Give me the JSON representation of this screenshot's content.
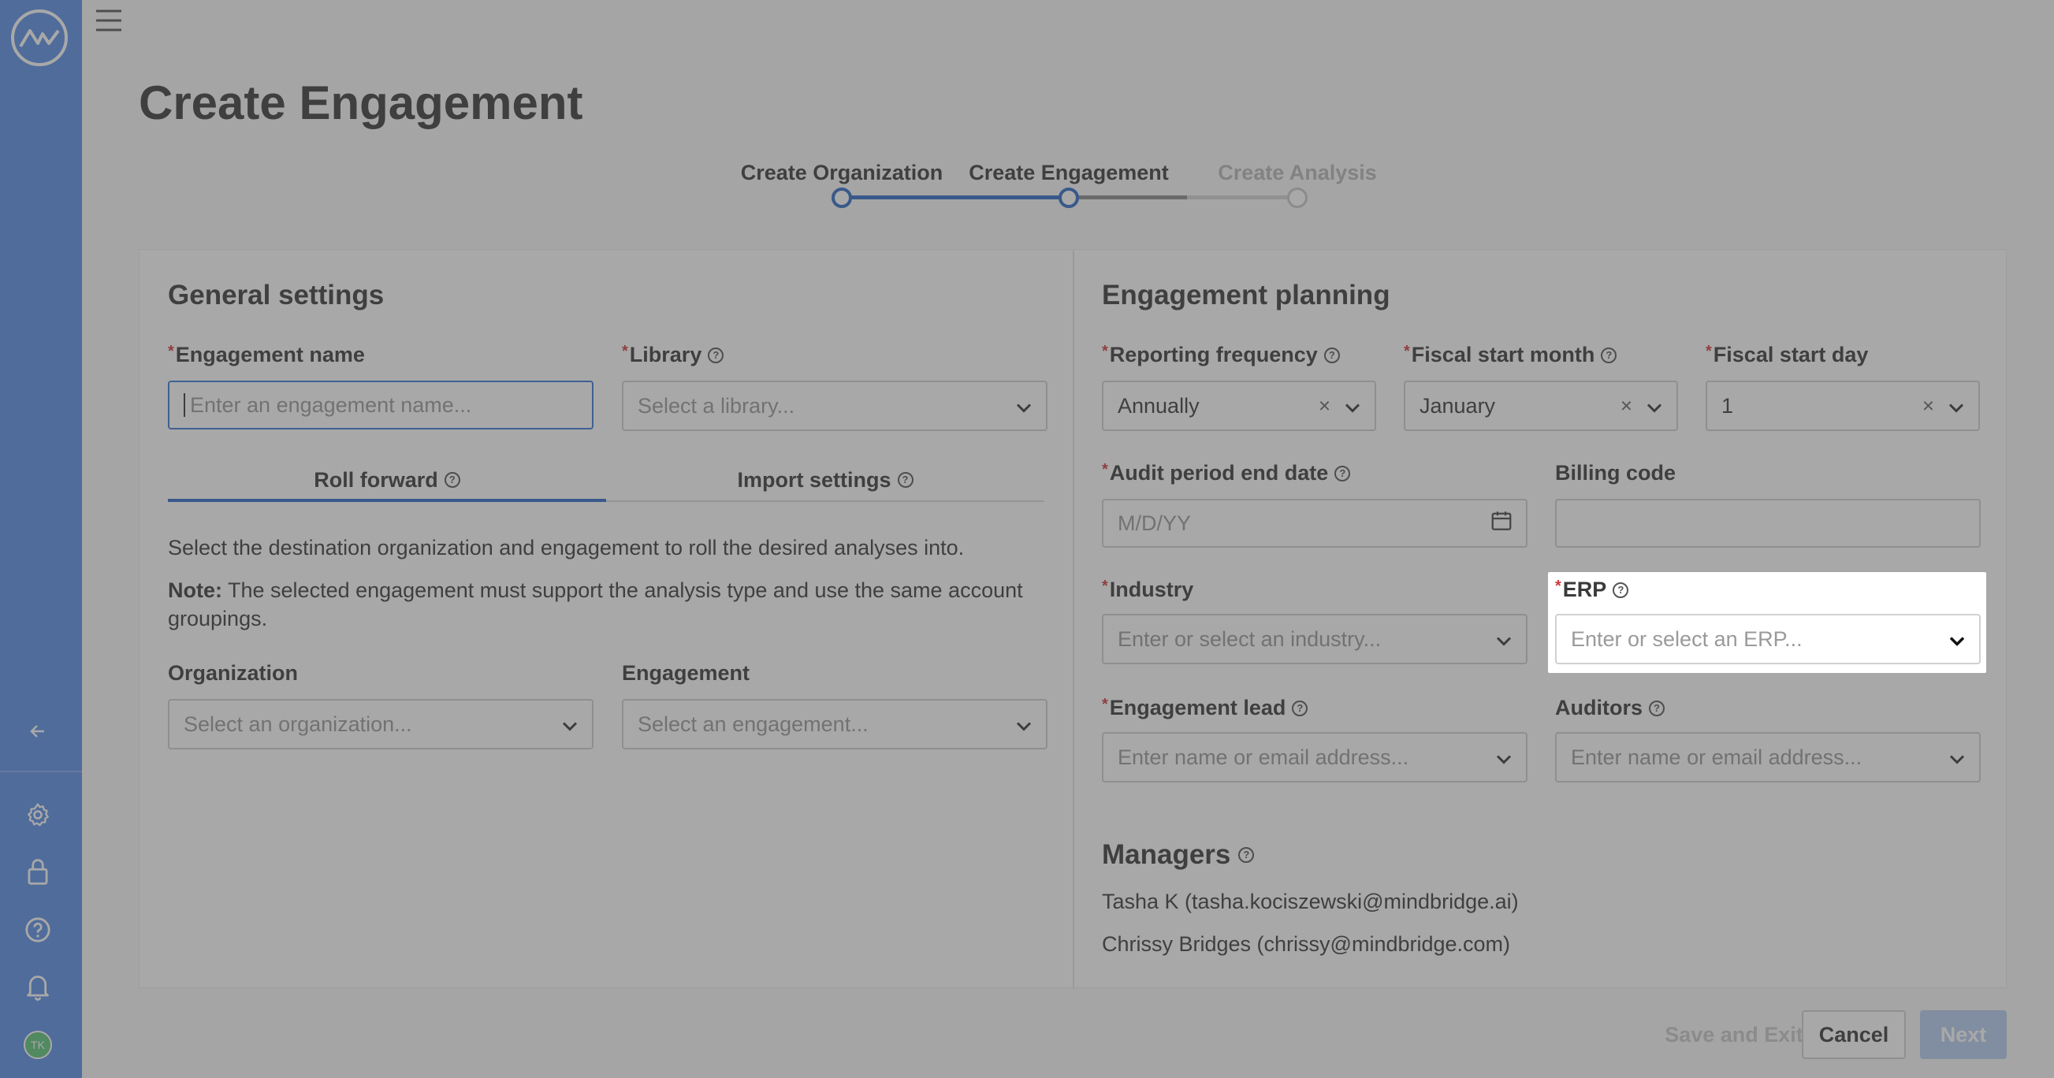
{
  "page": {
    "title": "Create Engagement"
  },
  "stepper": {
    "steps": [
      {
        "label": "Create Organization",
        "state": "complete"
      },
      {
        "label": "Create Engagement",
        "state": "active"
      },
      {
        "label": "Create Analysis",
        "state": "disabled"
      }
    ]
  },
  "sidebar": {
    "avatar_initials": "TK",
    "icons": [
      "collapse-icon",
      "gear-icon",
      "lock-icon",
      "help-icon",
      "bell-icon"
    ]
  },
  "general": {
    "title": "General settings",
    "engagement_name_label": "Engagement name",
    "engagement_name_placeholder": "Enter an engagement name...",
    "library_label": "Library",
    "library_placeholder": "Select a library...",
    "tabs": [
      "Roll forward",
      "Import settings"
    ],
    "description": "Select the destination organization and engagement to roll the desired analyses into.",
    "note_label": "Note:",
    "note_text": " The selected engagement must support the analysis type and use the same account groupings.",
    "organization_label": "Organization",
    "organization_placeholder": "Select an organization...",
    "engagement_label": "Engagement",
    "engagement_placeholder": "Select an engagement..."
  },
  "planning": {
    "title": "Engagement planning",
    "reporting_frequency_label": "Reporting frequency",
    "reporting_frequency_value": "Annually",
    "fiscal_start_month_label": "Fiscal start month",
    "fiscal_start_month_value": "January",
    "fiscal_start_day_label": "Fiscal start day",
    "fiscal_start_day_value": "1",
    "audit_period_label": "Audit period end date",
    "audit_period_placeholder": "M/D/YY",
    "billing_code_label": "Billing code",
    "industry_label": "Industry",
    "industry_placeholder": "Enter or select an industry...",
    "erp_label": "ERP",
    "erp_placeholder": "Enter or select an ERP...",
    "engagement_lead_label": "Engagement lead",
    "engagement_lead_placeholder": "Enter name or email address...",
    "auditors_label": "Auditors",
    "auditors_placeholder": "Enter name or email address...",
    "managers_title": "Managers",
    "managers": [
      "Tasha K (tasha.kociszewski@mindbridge.ai)",
      "Chrissy Bridges (chrissy@mindbridge.com)"
    ]
  },
  "footer": {
    "save_label": "Save and Exit",
    "cancel_label": "Cancel",
    "next_label": "Next"
  },
  "colors": {
    "sidebar": "#5a8fe6",
    "accent": "#2e6bc9",
    "required": "#d13a3a"
  }
}
